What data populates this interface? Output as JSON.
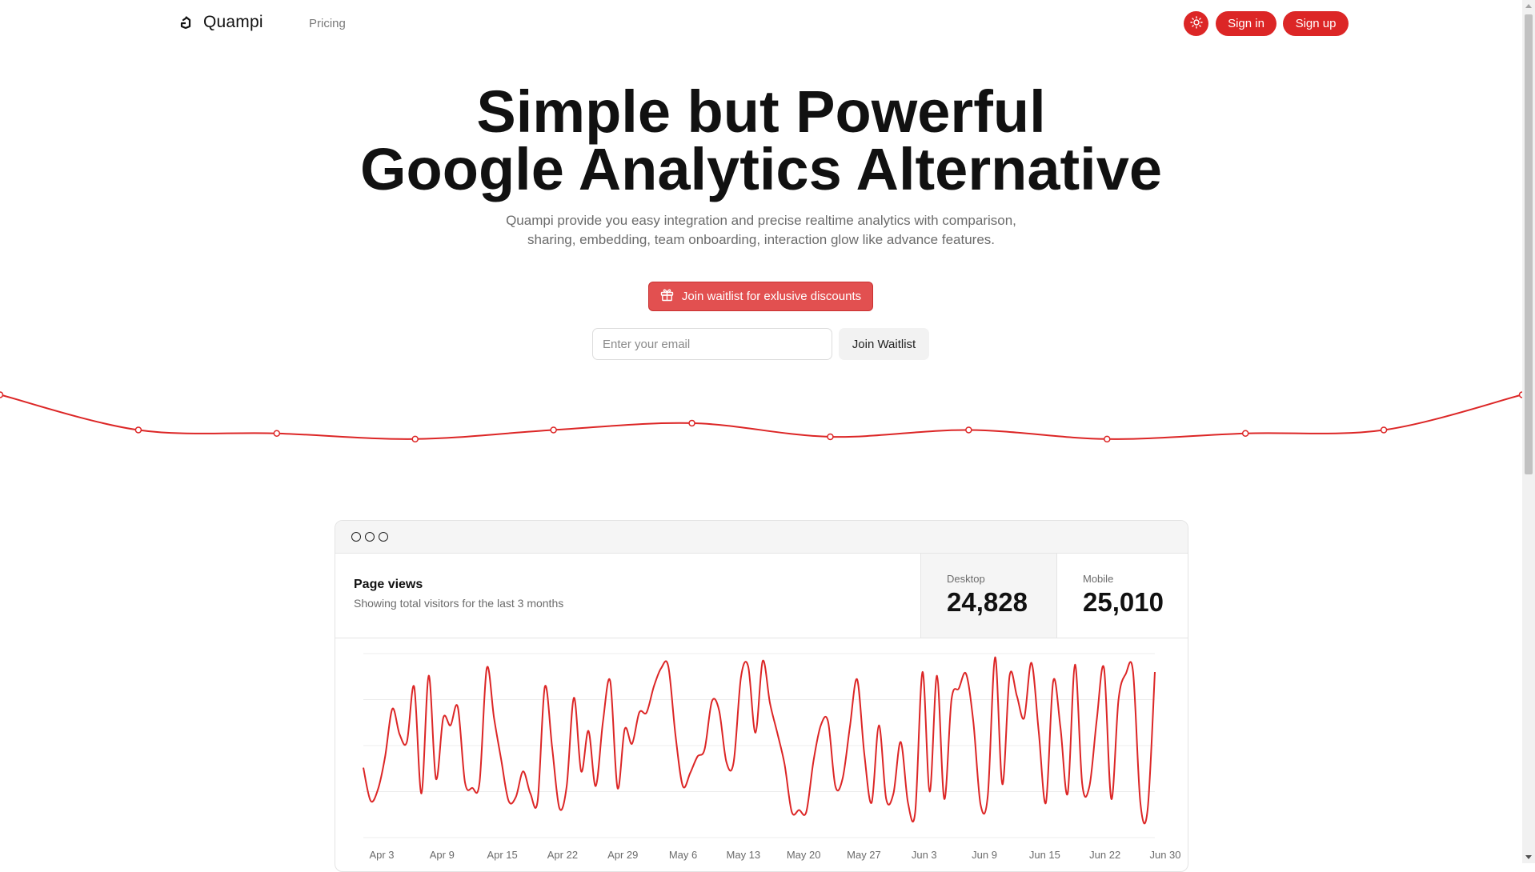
{
  "nav": {
    "brand": "Quampi",
    "links": [
      {
        "label": "Pricing"
      }
    ],
    "theme_toggle_icon": "sun-icon",
    "signin_label": "Sign in",
    "signup_label": "Sign up"
  },
  "hero": {
    "title_line1": "Simple but Powerful",
    "title_line2": "Google Analytics Alternative",
    "subtitle_line1": "Quampi provide you easy integration and precise realtime analytics with comparison,",
    "subtitle_line2": "sharing, embedding, team onboarding, interaction glow like advance features.",
    "cta_icon": "gift-icon",
    "cta_label": "Join waitlist for exlusive discounts",
    "email_placeholder": "Enter your email",
    "join_label": "Join Waitlist"
  },
  "colors": {
    "accent": "#dc2626",
    "cta_bg": "#e25050",
    "muted_text": "#6b6b6b"
  },
  "dashboard": {
    "title": "Page views",
    "subtitle": "Showing total visitors for the last 3 months",
    "stats": [
      {
        "label": "Desktop",
        "value": "24,828"
      },
      {
        "label": "Mobile",
        "value": "25,010"
      }
    ]
  },
  "chart_data": [
    {
      "type": "line",
      "y": [
        68,
        37,
        34,
        29,
        37,
        43,
        31,
        37,
        29,
        34,
        37,
        68
      ],
      "ylim": [
        0,
        100
      ],
      "markers": true
    },
    {
      "type": "line",
      "x_ticks": [
        "Apr 3",
        "Apr 9",
        "Apr 15",
        "Apr 22",
        "Apr 29",
        "May 6",
        "May 13",
        "May 20",
        "May 27",
        "Jun 3",
        "Jun 9",
        "Jun 15",
        "Jun 22",
        "Jun 30"
      ],
      "ylim": [
        0,
        100
      ],
      "grid": true,
      "values": [
        38,
        20,
        26,
        44,
        70,
        56,
        52,
        82,
        24,
        88,
        32,
        65,
        61,
        71,
        30,
        27,
        30,
        92,
        65,
        42,
        20,
        22,
        36,
        24,
        20,
        82,
        49,
        16,
        28,
        76,
        36,
        58,
        28,
        63,
        85,
        27,
        59,
        51,
        68,
        68,
        82,
        92,
        93,
        55,
        28,
        35,
        44,
        48,
        74,
        69,
        41,
        41,
        87,
        93,
        57,
        96,
        73,
        57,
        40,
        14,
        15,
        14,
        42,
        61,
        63,
        28,
        32,
        60,
        86,
        45,
        19,
        61,
        21,
        24,
        52,
        19,
        14,
        90,
        25,
        88,
        21,
        75,
        81,
        89,
        63,
        18,
        23,
        98,
        29,
        88,
        77,
        65,
        95,
        58,
        19,
        85,
        60,
        24,
        94,
        29,
        28,
        64,
        92,
        21,
        75,
        89,
        90,
        19,
        15,
        90
      ]
    }
  ]
}
